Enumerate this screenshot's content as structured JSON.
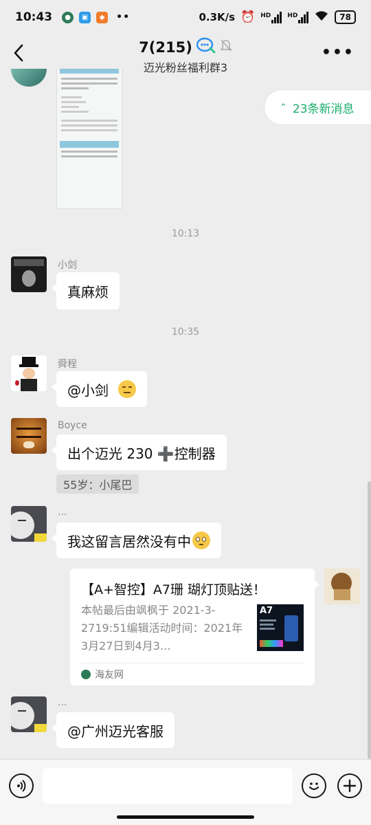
{
  "status_bar": {
    "time": "10:43",
    "speed": "0.3K/s",
    "hd1": "HD",
    "hd2": "HD",
    "battery": "78"
  },
  "header": {
    "title": "7(215)",
    "subtitle": "迈光粉丝福利群3"
  },
  "new_messages": {
    "label": "23条新消息"
  },
  "messages": [
    {
      "type": "time",
      "text": "10:13"
    },
    {
      "sender": "小剑",
      "text": "真麻烦"
    },
    {
      "type": "time",
      "text": "10:35"
    },
    {
      "sender": "舜程",
      "text": "@小剑"
    },
    {
      "sender": "Boyce",
      "text": "出个迈光 230 ➕控制器",
      "quote": "55岁：小尾巴"
    },
    {
      "sender": "...",
      "text": "我这留言居然没有中"
    },
    {
      "type": "link_card",
      "title": "【A+智控】A7珊 瑚灯顶贴送！",
      "desc": "本帖最后由飒枫于 2021-3-2719:51编辑活动时间：2021年3月27日到4月3…",
      "thumb_label": "A7",
      "source": "海友网"
    },
    {
      "sender": "...",
      "text": "@广州迈光客服"
    }
  ],
  "icons": {
    "back": "back-arrow-icon",
    "more": "more-dots-icon",
    "voice": "voice-input-icon",
    "emoji": "emoji-icon",
    "plus": "plus-icon"
  },
  "colors": {
    "background": "#ededed",
    "bubble": "#ffffff",
    "accent": "#1aad6c",
    "timestamp": "#9b9b9b"
  }
}
